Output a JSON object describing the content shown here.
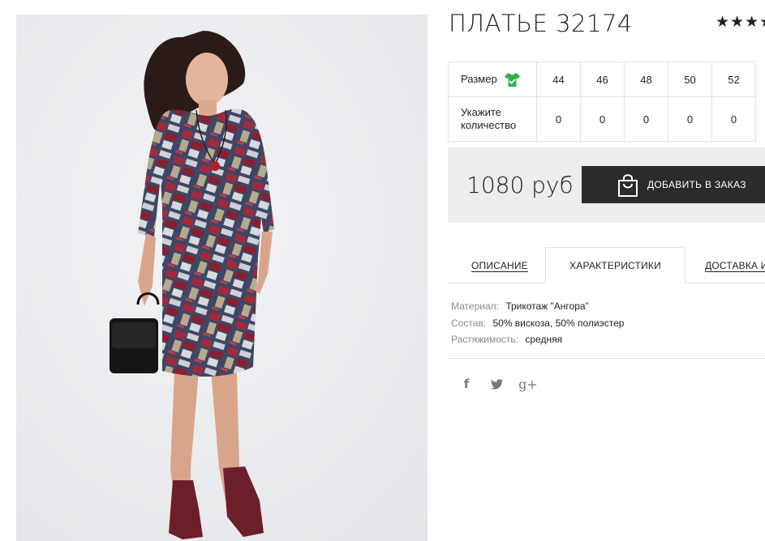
{
  "product": {
    "title": "ПЛАТЬЕ 32174",
    "rating_stars": "★★★★"
  },
  "size_table": {
    "size_label": "Размер",
    "qty_label_line1": "Укажите",
    "qty_label_line2": "количество",
    "sizes": [
      "44",
      "46",
      "48",
      "50",
      "52"
    ],
    "quantities": [
      "0",
      "0",
      "0",
      "0",
      "0"
    ]
  },
  "purchase": {
    "price": "1080 руб",
    "add_button_label": "ДОБАВИТЬ В ЗАКАЗ"
  },
  "tabs": {
    "description": "ОПИСАНИЕ",
    "characteristics": "ХАРАКТЕРИСТИКИ",
    "delivery": "ДОСТАВКА И"
  },
  "characteristics": [
    {
      "key": "Материал:",
      "value": "Трикотаж \"Ангора\""
    },
    {
      "key": "Состав:",
      "value": "50% вискоза, 50% полиэстер"
    },
    {
      "key": "Растяжимость:",
      "value": "средняя"
    }
  ],
  "social": {
    "facebook": "f",
    "twitter": "🐦",
    "google_plus": "g+"
  },
  "icons": {
    "size_chart": "shirt-icon",
    "cart": "shopping-bag-icon"
  },
  "colors": {
    "accent_green": "#2bb34a",
    "button_dark": "#2b2b2b",
    "price_bg": "#ededed"
  }
}
